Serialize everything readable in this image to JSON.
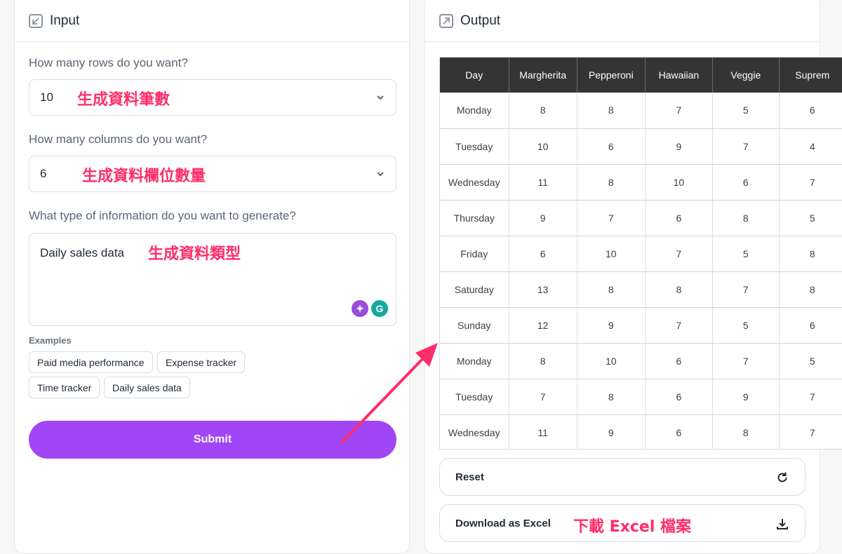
{
  "input_panel": {
    "title": "Input",
    "rows_label": "How many rows do you want?",
    "rows_value": "10",
    "rows_annotation": "生成資料筆數",
    "cols_label": "How many columns do you want?",
    "cols_value": "6",
    "cols_annotation": "生成資料欄位數量",
    "type_label": "What type of information do you want to generate?",
    "type_value": "Daily sales data",
    "type_annotation": "生成資料類型",
    "examples_label": "Examples",
    "examples": [
      "Paid media performance",
      "Expense tracker",
      "Time tracker",
      "Daily sales data"
    ],
    "submit_label": "Submit"
  },
  "output_panel": {
    "title": "Output",
    "headers": [
      "Day",
      "Margherita",
      "Pepperoni",
      "Hawaiian",
      "Veggie",
      "Suprem"
    ],
    "rows": [
      [
        "Monday",
        "8",
        "8",
        "7",
        "5",
        "6"
      ],
      [
        "Tuesday",
        "10",
        "6",
        "9",
        "7",
        "4"
      ],
      [
        "Wednesday",
        "11",
        "8",
        "10",
        "6",
        "7"
      ],
      [
        "Thursday",
        "9",
        "7",
        "6",
        "8",
        "5"
      ],
      [
        "Friday",
        "6",
        "10",
        "7",
        "5",
        "8"
      ],
      [
        "Saturday",
        "13",
        "8",
        "8",
        "7",
        "8"
      ],
      [
        "Sunday",
        "12",
        "9",
        "7",
        "5",
        "6"
      ],
      [
        "Monday",
        "8",
        "10",
        "6",
        "7",
        "5"
      ],
      [
        "Tuesday",
        "7",
        "8",
        "6",
        "9",
        "7"
      ],
      [
        "Wednesday",
        "11",
        "9",
        "6",
        "8",
        "7"
      ]
    ],
    "reset_label": "Reset",
    "download_label": "Download as Excel",
    "download_annotation": "下載 Excel 檔案"
  },
  "colors": {
    "accent": "#a146f6",
    "annotation": "#ff2d6a",
    "table_header_bg": "#343434"
  },
  "icons": {
    "input_header": "arrow-down-left-icon",
    "output_header": "arrow-up-right-icon",
    "select_chevron": "chevron-down-icon",
    "ai_sparkle": "sparkle-icon",
    "grammarly": "grammarly-icon",
    "reset": "refresh-icon",
    "download": "download-icon"
  }
}
